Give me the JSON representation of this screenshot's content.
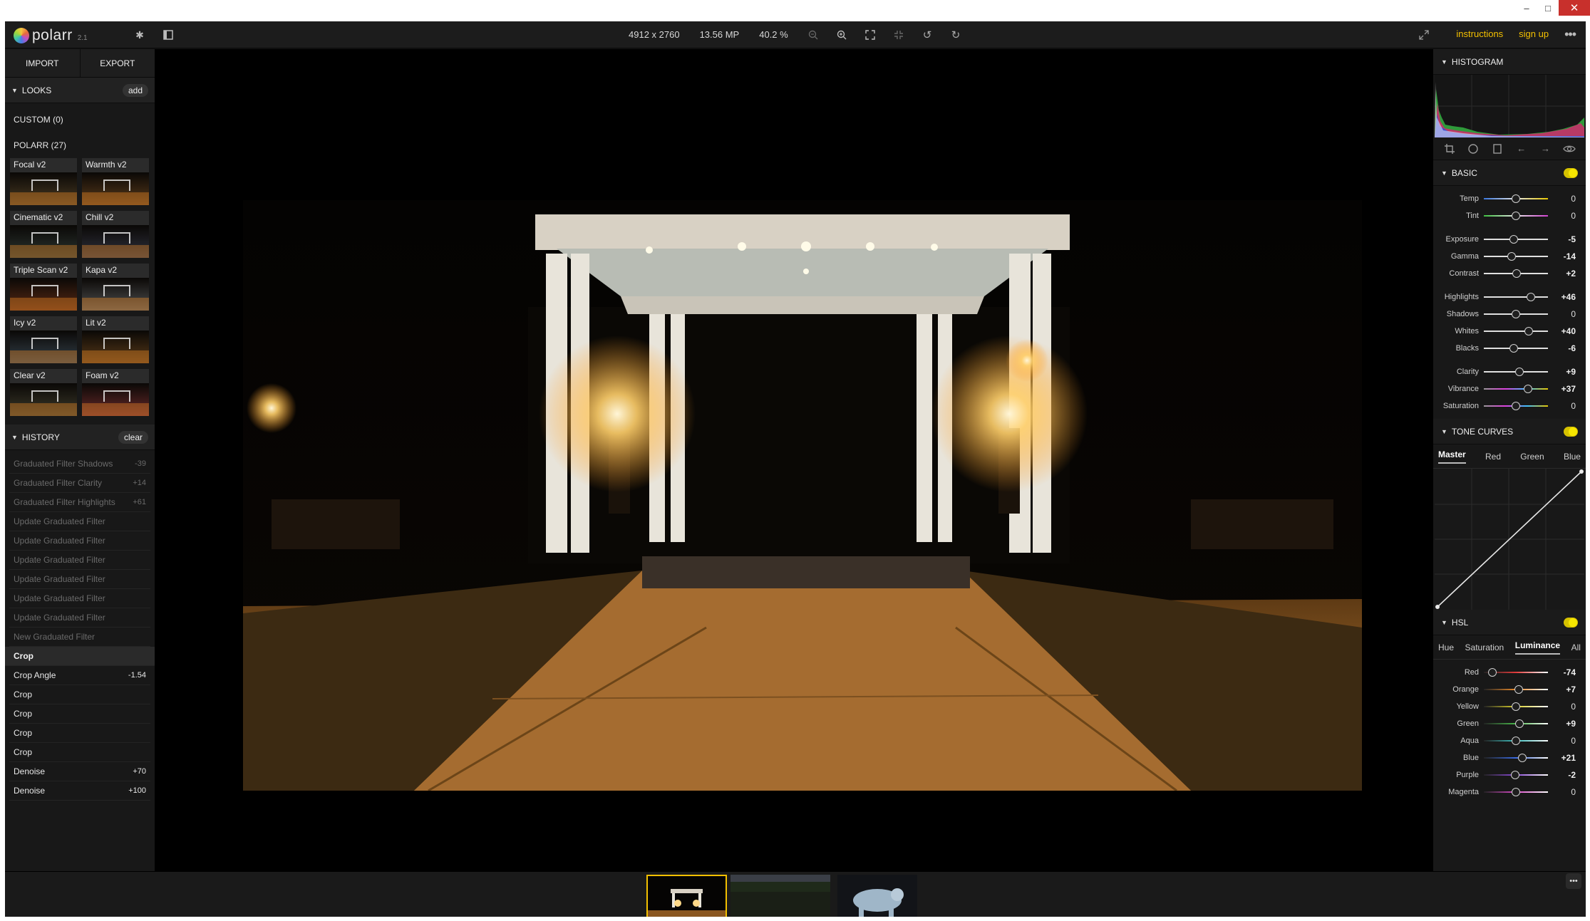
{
  "app": {
    "name": "polarr",
    "version": "2.1"
  },
  "topbar": {
    "dimensions": "4912 x 2760",
    "megapixels": "13.56 MP",
    "zoom": "40.2 %",
    "instructions": "instructions",
    "signup": "sign up"
  },
  "left": {
    "import": "IMPORT",
    "export": "EXPORT",
    "looks_title": "LOOKS",
    "looks_add": "add",
    "custom_group": "CUSTOM (0)",
    "polarr_group": "POLARR (27)",
    "looks": [
      {
        "name": "Focal v2",
        "tint": "#4a3a22"
      },
      {
        "name": "Warmth v2",
        "tint": "#5a3a1a"
      },
      {
        "name": "Cinematic v2",
        "tint": "#2b3530"
      },
      {
        "name": "Chill v2",
        "tint": "#30323e"
      },
      {
        "name": "Triple Scan v2",
        "tint": "#5a2a14"
      },
      {
        "name": "Kapa v2",
        "tint": "#505050"
      },
      {
        "name": "Icy v2",
        "tint": "#34404a"
      },
      {
        "name": "Lit v2",
        "tint": "#5a3a18"
      },
      {
        "name": "Clear v2",
        "tint": "#3d3a2a"
      },
      {
        "name": "Foam v2",
        "tint": "#6a2a2a"
      }
    ],
    "history_title": "HISTORY",
    "history_clear": "clear",
    "history": [
      {
        "label": "Graduated Filter Shadows",
        "value": "-39",
        "state": "faded"
      },
      {
        "label": "Graduated Filter Clarity",
        "value": "+14",
        "state": "faded"
      },
      {
        "label": "Graduated Filter Highlights",
        "value": "+61",
        "state": "faded"
      },
      {
        "label": "Update Graduated Filter",
        "value": "",
        "state": "faded"
      },
      {
        "label": "Update Graduated Filter",
        "value": "",
        "state": "faded"
      },
      {
        "label": "Update Graduated Filter",
        "value": "",
        "state": "faded"
      },
      {
        "label": "Update Graduated Filter",
        "value": "",
        "state": "faded"
      },
      {
        "label": "Update Graduated Filter",
        "value": "",
        "state": "faded"
      },
      {
        "label": "Update Graduated Filter",
        "value": "",
        "state": "faded"
      },
      {
        "label": "New Graduated Filter",
        "value": "",
        "state": "faded"
      },
      {
        "label": "Crop",
        "value": "",
        "state": "active"
      },
      {
        "label": "Crop Angle",
        "value": "-1.54",
        "state": "bright"
      },
      {
        "label": "Crop",
        "value": "",
        "state": "bright"
      },
      {
        "label": "Crop",
        "value": "",
        "state": "bright"
      },
      {
        "label": "Crop",
        "value": "",
        "state": "bright"
      },
      {
        "label": "Crop",
        "value": "",
        "state": "bright"
      },
      {
        "label": "Denoise",
        "value": "+70",
        "state": "bright"
      },
      {
        "label": "Denoise",
        "value": "+100",
        "state": "bright"
      }
    ]
  },
  "right": {
    "histogram_title": "HISTOGRAM",
    "basic_title": "BASIC",
    "basic": [
      {
        "label": "Temp",
        "value": "0",
        "pos": 0.5,
        "track": "temp"
      },
      {
        "label": "Tint",
        "value": "0",
        "pos": 0.5,
        "track": "tint"
      },
      {
        "gap": true
      },
      {
        "label": "Exposure",
        "value": "-5",
        "pos": 0.47,
        "track": "plain"
      },
      {
        "label": "Gamma",
        "value": "-14",
        "pos": 0.43,
        "track": "plain"
      },
      {
        "label": "Contrast",
        "value": "+2",
        "pos": 0.51,
        "track": "plain"
      },
      {
        "gap": true
      },
      {
        "label": "Highlights",
        "value": "+46",
        "pos": 0.73,
        "track": "plain"
      },
      {
        "label": "Shadows",
        "value": "0",
        "pos": 0.5,
        "track": "plain"
      },
      {
        "label": "Whites",
        "value": "+40",
        "pos": 0.7,
        "track": "plain"
      },
      {
        "label": "Blacks",
        "value": "-6",
        "pos": 0.47,
        "track": "plain"
      },
      {
        "gap": true
      },
      {
        "label": "Clarity",
        "value": "+9",
        "pos": 0.55,
        "track": "plain"
      },
      {
        "label": "Vibrance",
        "value": "+37",
        "pos": 0.69,
        "track": "vibrance"
      },
      {
        "label": "Saturation",
        "value": "0",
        "pos": 0.5,
        "track": "saturation"
      }
    ],
    "curves_title": "TONE CURVES",
    "curve_tabs": [
      "Master",
      "Red",
      "Green",
      "Blue"
    ],
    "hsl_title": "HSL",
    "hsl_tabs": [
      "Hue",
      "Saturation",
      "Luminance",
      "All"
    ],
    "hsl": [
      {
        "label": "Red",
        "value": "-74",
        "pos": 0.13,
        "color": "#e03a3a"
      },
      {
        "label": "Orange",
        "value": "+7",
        "pos": 0.54,
        "color": "#e8892a"
      },
      {
        "label": "Yellow",
        "value": "0",
        "pos": 0.5,
        "color": "#d8cf2a"
      },
      {
        "label": "Green",
        "value": "+9",
        "pos": 0.55,
        "color": "#49b74a"
      },
      {
        "label": "Aqua",
        "value": "0",
        "pos": 0.5,
        "color": "#3ec0c0"
      },
      {
        "label": "Blue",
        "value": "+21",
        "pos": 0.6,
        "color": "#3a6ae0"
      },
      {
        "label": "Purple",
        "value": "-2",
        "pos": 0.49,
        "color": "#8a4ad8"
      },
      {
        "label": "Magenta",
        "value": "0",
        "pos": 0.5,
        "color": "#d84ac8"
      }
    ]
  },
  "colors": {
    "accent": "#f3c000",
    "toggle": "#f6e600"
  }
}
